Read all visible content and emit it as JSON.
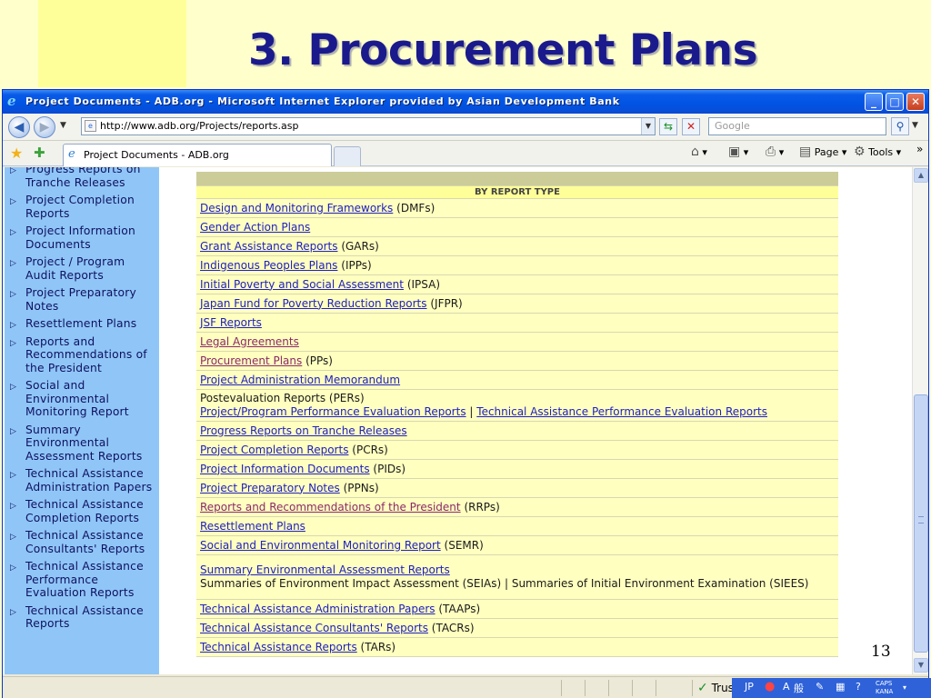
{
  "slide": {
    "title": "3. Procurement Plans",
    "number": "13"
  },
  "window": {
    "title": "Project Documents - ADB.org - Microsoft Internet Explorer provided by Asian Development Bank",
    "buttons": {
      "minimize": "_",
      "maximize": "□",
      "close": "✕"
    }
  },
  "address": {
    "url": "http://www.adb.org/Projects/reports.asp",
    "search_placeholder": "Google"
  },
  "tab": {
    "label": "Project Documents - ADB.org"
  },
  "commands": {
    "page": "Page",
    "tools": "Tools"
  },
  "sidebar": {
    "items": [
      "Progress Reports on Tranche Releases",
      "Project Completion Reports",
      "Project Information Documents",
      "Project / Program Audit Reports",
      "Project Preparatory Notes",
      "Resettlement Plans",
      "Reports and Recommendations of the President",
      "Social and Environmental Monitoring Report",
      "Summary Environmental Assessment Reports",
      "Technical Assistance Administration Papers",
      "Technical Assistance Completion Reports",
      "Technical Assistance Consultants' Reports",
      "Technical Assistance Performance Evaluation Reports",
      "Technical Assistance Reports"
    ]
  },
  "table": {
    "header": "BY REPORT TYPE",
    "rows": [
      {
        "link": "Design and Monitoring Frameworks",
        "suffix": "(DMFs)"
      },
      {
        "link": "Gender Action Plans",
        "suffix": ""
      },
      {
        "link": "Grant Assistance Reports",
        "suffix": "(GARs)"
      },
      {
        "link": "Indigenous Peoples Plans",
        "suffix": "(IPPs)"
      },
      {
        "link": "Initial Poverty and Social Assessment",
        "suffix": "(IPSA)"
      },
      {
        "link": "Japan Fund for Poverty Reduction Reports",
        "suffix": "(JFPR)"
      },
      {
        "link": "JSF Reports",
        "suffix": ""
      },
      {
        "link": "Legal Agreements",
        "suffix": ""
      },
      {
        "link": "Procurement Plans",
        "suffix": "(PPs)"
      },
      {
        "link": "Project Administration Memorandum",
        "suffix": ""
      },
      {
        "text": "Postevaluation Reports (PERs)",
        "link": "Project/Program Performance Evaluation Reports",
        "sep": "|",
        "link2": "Technical Assistance Performance Evaluation Reports"
      },
      {
        "link": "Progress Reports on Tranche Releases",
        "suffix": ""
      },
      {
        "link": "Project Completion Reports",
        "suffix": "(PCRs)"
      },
      {
        "link": "Project Information Documents",
        "suffix": "(PIDs)"
      },
      {
        "link": "Project Preparatory Notes",
        "suffix": "(PPNs)"
      },
      {
        "link": "Reports and Recommendations of the President",
        "suffix": "(RRPs)"
      },
      {
        "link": "Resettlement Plans",
        "suffix": ""
      },
      {
        "link": "Social and Environmental Monitoring Report",
        "suffix": "(SEMR)"
      },
      {
        "link": "Summary Environmental Assessment Reports",
        "text": "Summaries of Environment Impact Assessment (SEIAs) | Summaries of Initial Environment Examination (SIEES)"
      },
      {
        "link": "Technical Assistance Administration Papers",
        "suffix": "(TAAPs)"
      },
      {
        "link": "Technical Assistance Consultants' Reports",
        "suffix": "(TACRs)"
      },
      {
        "link": "Technical Assistance Reports",
        "suffix": "(TARs)"
      }
    ]
  },
  "status": {
    "zone": "Trus",
    "lang": "JP",
    "ime_a": "A",
    "ime_kanji": "般",
    "caps": "CAPS",
    "kana": "KANA"
  },
  "colors": {
    "slide_bg": "#ffffcc",
    "title": "#1a1a8c",
    "sidebar": "#8fc6f7",
    "table_row": "#ffffc0",
    "link": "#2020c0"
  }
}
